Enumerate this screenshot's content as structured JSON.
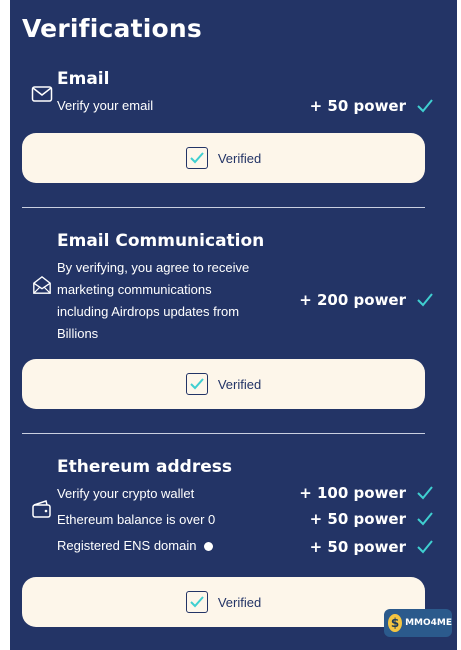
{
  "title": "Verifications",
  "email": {
    "title": "Email",
    "description": "Verify your email",
    "power": "+ 50 power",
    "button_label": "Verified"
  },
  "email_comm": {
    "title": "Email Communication",
    "description_lines": [
      "By verifying, you agree to receive",
      "marketing communications",
      "including Airdrops updates from",
      "Billions"
    ],
    "power": "+ 200 power",
    "button_label": "Verified"
  },
  "ethereum": {
    "title": "Ethereum address",
    "items": [
      {
        "label": "Verify your crypto wallet",
        "power": "+ 100 power"
      },
      {
        "label": "Ethereum balance is over 0",
        "power": "+ 50 power"
      },
      {
        "label": "Registered ENS domain",
        "power": "+ 50 power"
      }
    ],
    "button_label": "Verified"
  },
  "watermark": {
    "text": "MMO4ME",
    "coin_symbol": "$"
  },
  "colors": {
    "panel": "#233466",
    "button_bg": "#fdf6ea",
    "check": "#3fcfd0",
    "text": "#ffffff"
  }
}
